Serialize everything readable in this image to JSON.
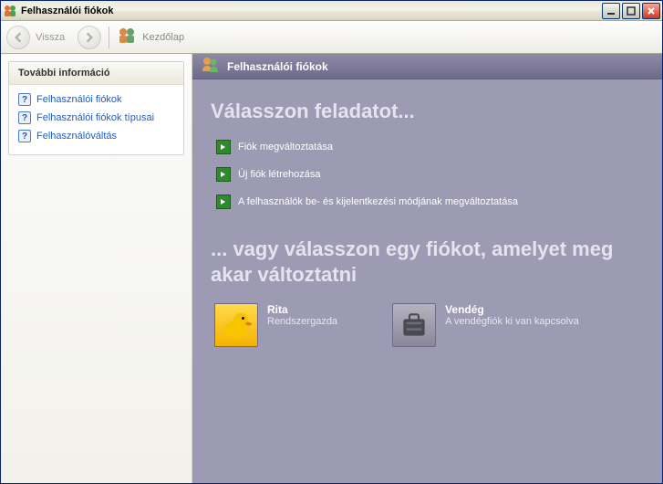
{
  "window": {
    "title": "Felhasználói fiókok"
  },
  "toolbar": {
    "back_label": "Vissza",
    "home_label": "Kezdőlap"
  },
  "sidebar": {
    "panel_title": "További információ",
    "items": [
      {
        "label": "Felhasználói fiókok"
      },
      {
        "label": "Felhasználói fiókok típusai"
      },
      {
        "label": "Felhasználóváltás"
      }
    ]
  },
  "content": {
    "header_title": "Felhasználói fiókok",
    "heading1": "Válasszon feladatot...",
    "tasks": [
      {
        "label": "Fiók megváltoztatása"
      },
      {
        "label": "Új fiók létrehozása"
      },
      {
        "label": "A felhasználók be- és kijelentkezési módjának megváltoztatása"
      }
    ],
    "heading2": "... vagy válasszon egy fiókot, amelyet meg akar változtatni",
    "accounts": [
      {
        "name": "Rita",
        "desc": "Rendszergazda"
      },
      {
        "name": "Vendég",
        "desc": "A vendégfiók ki van kapcsolva"
      }
    ]
  }
}
